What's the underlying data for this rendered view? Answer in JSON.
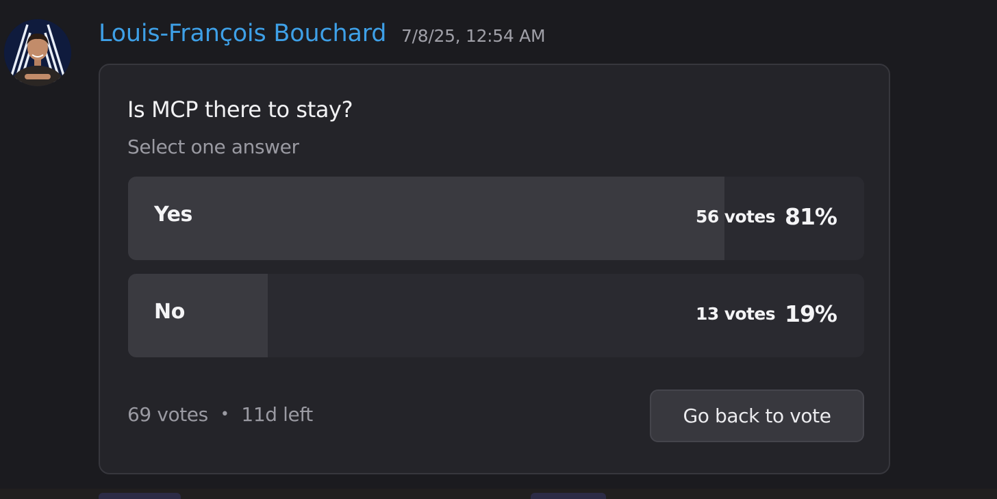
{
  "message": {
    "author": "Louis-François Bouchard",
    "timestamp": "7/8/25, 12:54 AM",
    "avatar_icon": "user-avatar-icon"
  },
  "poll": {
    "question": "Is MCP there to stay?",
    "instruction": "Select one answer",
    "answers": [
      {
        "label": "Yes",
        "votes_text": "56 votes",
        "percent_text": "81%",
        "percent": 81
      },
      {
        "label": "No",
        "votes_text": "13 votes",
        "percent_text": "19%",
        "percent": 19
      }
    ],
    "total_votes": "69 votes",
    "separator": "•",
    "time_left": "11d left",
    "button_label": "Go back to vote"
  },
  "colors": {
    "background": "#1b1b1f",
    "author": "#3ea0e7",
    "card": "#242429",
    "bar_track": "#2a2a30",
    "bar_fill": "#3a3a40",
    "muted_text": "#9a9aa2"
  }
}
